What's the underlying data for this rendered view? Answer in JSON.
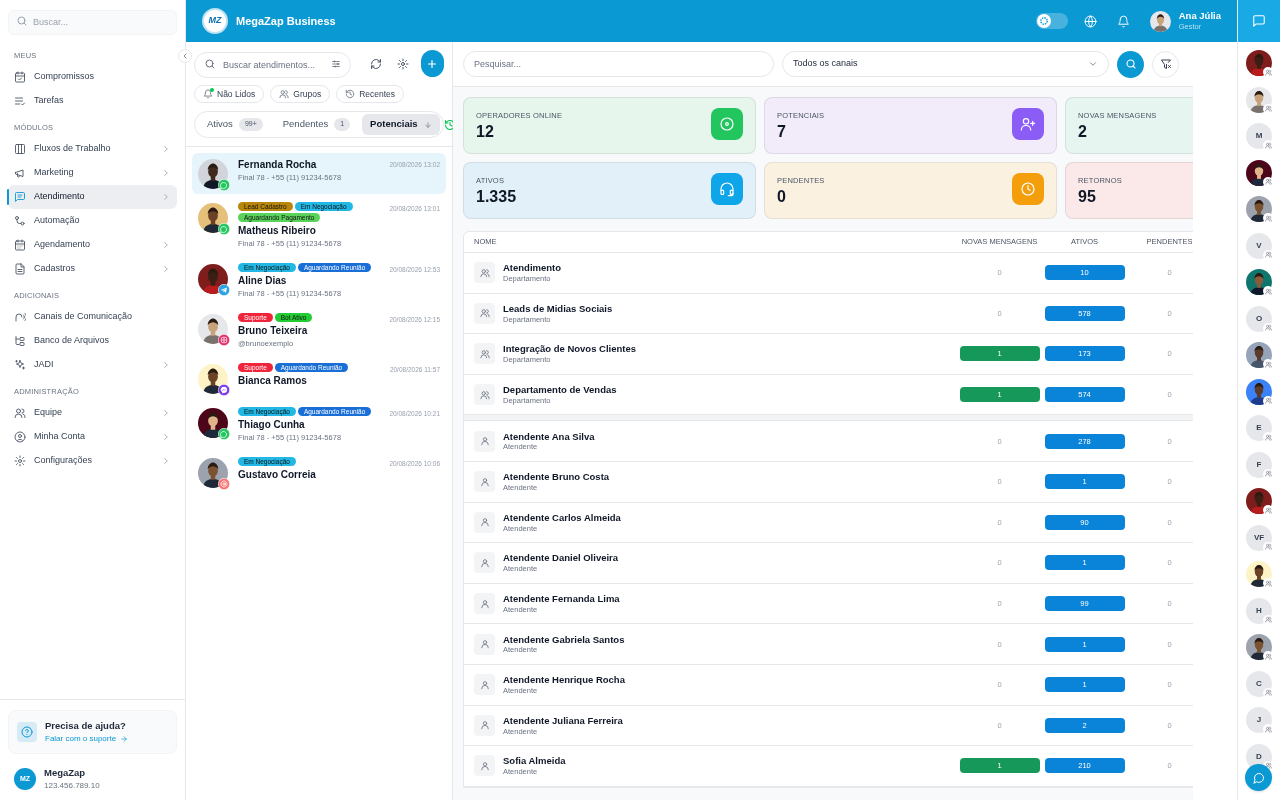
{
  "sidebar": {
    "search_placeholder": "Buscar...",
    "sections": [
      {
        "title": "MEUS",
        "items": [
          {
            "label": "Compromissos",
            "expandable": false,
            "selected": false
          },
          {
            "label": "Tarefas",
            "expandable": false,
            "selected": false
          }
        ]
      },
      {
        "title": "MÓDULOS",
        "items": [
          {
            "label": "Fluxos de Trabalho",
            "expandable": true,
            "selected": false
          },
          {
            "label": "Marketing",
            "expandable": true,
            "selected": false
          },
          {
            "label": "Atendimento",
            "expandable": true,
            "selected": true
          },
          {
            "label": "Automação",
            "expandable": false,
            "selected": false
          },
          {
            "label": "Agendamento",
            "expandable": true,
            "selected": false
          },
          {
            "label": "Cadastros",
            "expandable": true,
            "selected": false
          }
        ]
      },
      {
        "title": "ADICIONAIS",
        "items": [
          {
            "label": "Canais de Comunicação",
            "expandable": false,
            "selected": false
          },
          {
            "label": "Banco de Arquivos",
            "expandable": false,
            "selected": false
          },
          {
            "label": "JADI",
            "expandable": true,
            "selected": false
          }
        ]
      },
      {
        "title": "ADMINISTRAÇÃO",
        "items": [
          {
            "label": "Equipe",
            "expandable": true,
            "selected": false
          },
          {
            "label": "Minha Conta",
            "expandable": true,
            "selected": false
          },
          {
            "label": "Configurações",
            "expandable": true,
            "selected": false
          }
        ]
      }
    ],
    "help": {
      "title": "Precisa de ajuda?",
      "link": "Falar com o suporte"
    },
    "account": {
      "initials": "MZ",
      "name": "MegaZap",
      "id": "123.456.789.10"
    }
  },
  "topbar": {
    "logo": "MZ",
    "title": "MegaZap Business",
    "theme_toggle": {
      "on": false
    },
    "user": {
      "name": "Ana Júlia",
      "role": "Gestor"
    }
  },
  "conversations_panel": {
    "search_placeholder": "Buscar atendimentos...",
    "filters": [
      "Não Lidos",
      "Grupos",
      "Recentes"
    ],
    "tabs": [
      {
        "label": "Ativos",
        "count": "99+",
        "selected": false
      },
      {
        "label": "Pendentes",
        "count": "1",
        "selected": false
      },
      {
        "label": "Potenciais",
        "selected": true
      }
    ],
    "conversations": [
      {
        "name": "Fernanda Rocha",
        "subtitle": "Final 78 - +55 (11) 91234-5678",
        "time": "20/08/2026 13:02",
        "kind": "whatsapp",
        "selected": true
      },
      {
        "name": "Matheus Ribeiro",
        "subtitle": "Final 78 - +55 (11) 91234-5678",
        "time": "20/08/2026 13:01",
        "kind": "whatsapp",
        "selected": false,
        "tags": [
          {
            "label": "Lead Cadastro",
            "color": "#b8860b"
          },
          {
            "label": "Em Negociação",
            "color": "#22b8e6"
          },
          {
            "label": "Aguardando Pagamento",
            "color": "#5ad35a"
          }
        ]
      },
      {
        "name": "Aline Dias",
        "subtitle": "Final 78 - +55 (11) 91234-5678",
        "time": "20/08/2026 12:53",
        "kind": "telegram",
        "selected": false,
        "tags": [
          {
            "label": "Em Negociação",
            "color": "#22b8e6"
          },
          {
            "label": "Aguardando Reunião",
            "color": "#1a6fd6"
          }
        ]
      },
      {
        "name": "Bruno Teixeira",
        "subtitle": "@brunoexemplo",
        "time": "20/08/2026 12:15",
        "kind": "instagram",
        "selected": false,
        "tags": [
          {
            "label": "Suporte",
            "color": "#f0243a"
          },
          {
            "label": "Bot Ativo",
            "color": "#22cc33"
          }
        ]
      },
      {
        "name": "Bianca Ramos",
        "time": "20/08/2026 11:57",
        "kind": "messenger",
        "selected": false,
        "tags": [
          {
            "label": "Suporte",
            "color": "#f0243a"
          },
          {
            "label": "Aguardando Reunião",
            "color": "#1a6fd6"
          }
        ]
      },
      {
        "name": "Thiago Cunha",
        "subtitle": "Final 78 - +55 (11) 91234-5678",
        "time": "20/08/2026 10:21",
        "kind": "whatsapp",
        "selected": false,
        "tags": [
          {
            "label": "Em Negociação",
            "color": "#22b8e6"
          },
          {
            "label": "Aguardando Reunião",
            "color": "#1a6fd6"
          }
        ]
      },
      {
        "name": "Gustavo Correia",
        "time": "20/08/2026 10:06",
        "kind": "email",
        "selected": false,
        "tags": [
          {
            "label": "Em Negociação",
            "color": "#22b8e6"
          }
        ]
      }
    ]
  },
  "dashboard": {
    "search_placeholder": "Pesquisar...",
    "channel_select": "Todos os canais",
    "stats": [
      {
        "label": "OPERADORES ONLINE",
        "value": "12",
        "color": "#e6f6ec",
        "kind": "target"
      },
      {
        "label": "POTENCIAIS",
        "value": "7",
        "color": "#f1ebfa",
        "kind": "user-plus"
      },
      {
        "label": "NOVAS MENSAGENS",
        "value": "2",
        "color": "#e6f5ef",
        "kind": "none"
      },
      {
        "label": "ATIVOS",
        "value": "1.335",
        "color": "#e2f0f9",
        "kind": "headset"
      },
      {
        "label": "PENDENTES",
        "value": "0",
        "color": "#faf1e1",
        "kind": "clock"
      },
      {
        "label": "RETORNOS",
        "value": "95",
        "color": "#fbe8e8",
        "kind": "none"
      }
    ],
    "table": {
      "columns": [
        "NOME",
        "NOVAS MENSAGENS",
        "ATIVOS",
        "PENDENTES"
      ],
      "groups": [
        {
          "rows": [
            {
              "kind": "department",
              "name": "Atendimento",
              "subtitle": "Departamento",
              "novas": "0",
              "novas_highlight": false,
              "ativos": "10",
              "pendentes": "0"
            },
            {
              "kind": "department",
              "name": "Leads de Midias Sociais",
              "subtitle": "Departamento",
              "novas": "0",
              "novas_highlight": false,
              "ativos": "578",
              "pendentes": "0"
            },
            {
              "kind": "department",
              "name": "Integração de Novos Clientes",
              "subtitle": "Departamento",
              "novas": "1",
              "novas_highlight": true,
              "ativos": "173",
              "pendentes": "0"
            },
            {
              "kind": "department",
              "name": "Departamento de Vendas",
              "subtitle": "Departamento",
              "novas": "1",
              "novas_highlight": true,
              "ativos": "574",
              "pendentes": "0"
            }
          ]
        },
        {
          "rows": [
            {
              "kind": "agent",
              "name": "Atendente Ana Silva",
              "subtitle": "Atendente",
              "novas": "0",
              "novas_highlight": false,
              "ativos": "278",
              "pendentes": "0"
            },
            {
              "kind": "agent",
              "name": "Atendente Bruno Costa",
              "subtitle": "Atendente",
              "novas": "0",
              "novas_highlight": false,
              "ativos": "1",
              "pendentes": "0"
            },
            {
              "kind": "agent",
              "name": "Atendente Carlos Almeida",
              "subtitle": "Atendente",
              "novas": "0",
              "novas_highlight": false,
              "ativos": "90",
              "pendentes": "0"
            },
            {
              "kind": "agent",
              "name": "Atendente Daniel Oliveira",
              "subtitle": "Atendente",
              "novas": "0",
              "novas_highlight": false,
              "ativos": "1",
              "pendentes": "0"
            },
            {
              "kind": "agent",
              "name": "Atendente Fernanda Lima",
              "subtitle": "Atendente",
              "novas": "0",
              "novas_highlight": false,
              "ativos": "99",
              "pendentes": "0"
            },
            {
              "kind": "agent",
              "name": "Atendente Gabriela Santos",
              "subtitle": "Atendente",
              "novas": "0",
              "novas_highlight": false,
              "ativos": "1",
              "pendentes": "0"
            },
            {
              "kind": "agent",
              "name": "Atendente Henrique Rocha",
              "subtitle": "Atendente",
              "novas": "0",
              "novas_highlight": false,
              "ativos": "1",
              "pendentes": "0"
            },
            {
              "kind": "agent",
              "name": "Atendente Juliana Ferreira",
              "subtitle": "Atendente",
              "novas": "0",
              "novas_highlight": false,
              "ativos": "2",
              "pendentes": "0"
            },
            {
              "kind": "agent",
              "name": "Sofia Almeida",
              "subtitle": "Atendente",
              "novas": "1",
              "novas_highlight": true,
              "ativos": "210",
              "pendentes": "0"
            }
          ]
        }
      ]
    }
  },
  "contacts": [
    {
      "kind": "picture"
    },
    {
      "kind": "picture"
    },
    {
      "kind": "initials",
      "initials": "M"
    },
    {
      "kind": "picture"
    },
    {
      "kind": "picture"
    },
    {
      "kind": "initials",
      "initials": "V"
    },
    {
      "kind": "picture"
    },
    {
      "kind": "initials",
      "initials": "O"
    },
    {
      "kind": "picture"
    },
    {
      "kind": "picture"
    },
    {
      "kind": "initials",
      "initials": "E"
    },
    {
      "kind": "initials",
      "initials": "F"
    },
    {
      "kind": "picture"
    },
    {
      "kind": "initials",
      "initials": "VF"
    },
    {
      "kind": "picture"
    },
    {
      "kind": "initials",
      "initials": "H"
    },
    {
      "kind": "picture"
    },
    {
      "kind": "initials",
      "initials": "C"
    },
    {
      "kind": "initials",
      "initials": "J"
    },
    {
      "kind": "initials",
      "initials": "D"
    }
  ]
}
